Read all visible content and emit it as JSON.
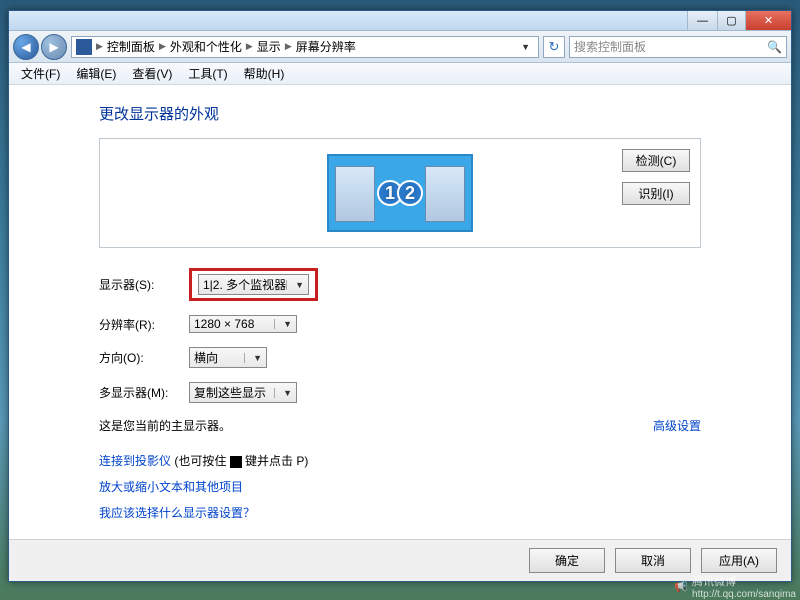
{
  "titlebar": {
    "min": "—",
    "max": "▢",
    "close": "✕"
  },
  "nav": {
    "back": "◀",
    "fwd": "▶",
    "refresh": "↻"
  },
  "breadcrumb": {
    "c1": "控制面板",
    "c2": "外观和个性化",
    "c3": "显示",
    "c4": "屏幕分辨率"
  },
  "search": {
    "placeholder": "搜索控制面板"
  },
  "menu": {
    "file": "文件(F)",
    "edit": "编辑(E)",
    "view": "查看(V)",
    "tools": "工具(T)",
    "help": "帮助(H)"
  },
  "heading": "更改显示器的外观",
  "sidebtns": {
    "detect": "检测(C)",
    "identify": "识别(I)"
  },
  "monitors": {
    "n1": "1",
    "n2": "2"
  },
  "form": {
    "display_label": "显示器(S):",
    "display_value": "1|2. 多个监视器",
    "resolution_label": "分辨率(R):",
    "resolution_value": "1280 × 768",
    "orientation_label": "方向(O):",
    "orientation_value": "横向",
    "multi_label": "多显示器(M):",
    "multi_value": "复制这些显示"
  },
  "note_text": "这是您当前的主显示器。",
  "advanced_link": "高级设置",
  "links": {
    "projector_pre": "连接到投影仪",
    "projector_post": " (也可按住 ",
    "projector_end": " 键并点击 P)",
    "zoom": "放大或缩小文本和其他项目",
    "which": "我应该选择什么显示器设置？"
  },
  "footer": {
    "ok": "确定",
    "cancel": "取消",
    "apply": "应用(A)"
  },
  "watermark": {
    "brand": "腾讯微博",
    "url": "http://t.qq.com/sanqima"
  }
}
